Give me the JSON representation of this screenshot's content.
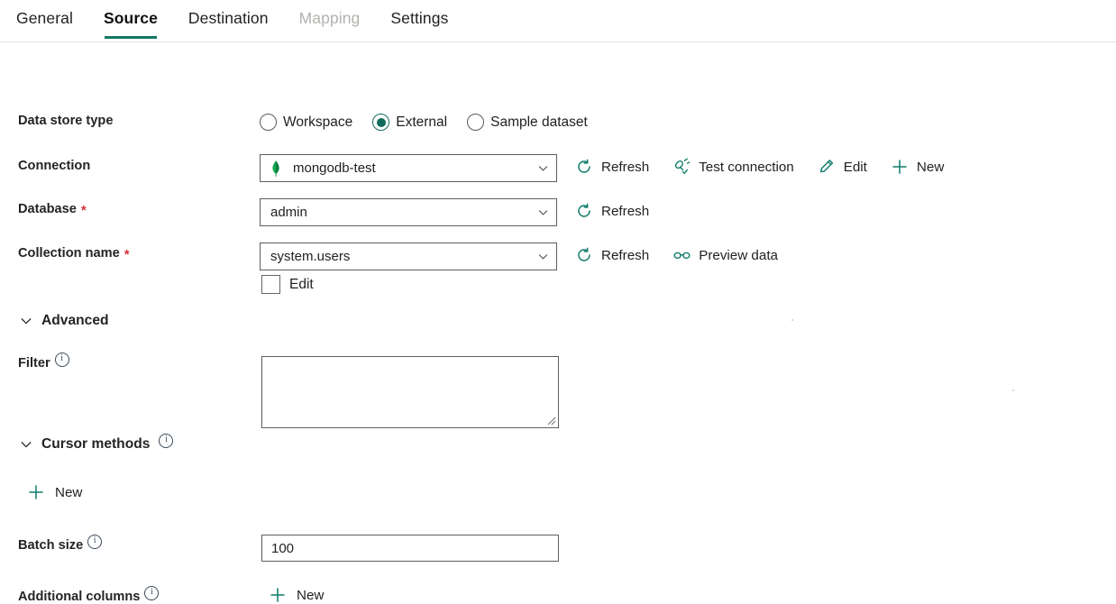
{
  "tabs": [
    {
      "label": "General",
      "state": "normal"
    },
    {
      "label": "Source",
      "state": "active"
    },
    {
      "label": "Destination",
      "state": "normal"
    },
    {
      "label": "Mapping",
      "state": "disabled"
    },
    {
      "label": "Settings",
      "state": "normal"
    }
  ],
  "colors": {
    "accent_teal": "#117865",
    "radio_selected": "#0f6b5c",
    "icon_teal": "#0f7b6c",
    "required_red": "#d13438",
    "mongo_green": "#13aa52",
    "border": "#605e5c",
    "disabled_text": "#b4b1ae"
  },
  "fields": {
    "data_store_type": {
      "label": "Data store type",
      "options": [
        {
          "label": "Workspace",
          "selected": false
        },
        {
          "label": "External",
          "selected": true
        },
        {
          "label": "Sample dataset",
          "selected": false
        }
      ]
    },
    "connection": {
      "label": "Connection",
      "value": "mongodb-test",
      "icon": "mongodb-leaf-icon",
      "dropdown_icon": "chevron-down-icon",
      "commands": [
        {
          "label": "Refresh",
          "icon": "refresh-icon"
        },
        {
          "label": "Test connection",
          "icon": "plug-check-icon"
        },
        {
          "label": "Edit",
          "icon": "pencil-icon"
        },
        {
          "label": "New",
          "icon": "plus-icon"
        }
      ]
    },
    "database": {
      "label": "Database",
      "required": "*",
      "value": "admin",
      "dropdown_icon": "chevron-down-icon",
      "commands": [
        {
          "label": "Refresh",
          "icon": "refresh-icon"
        }
      ]
    },
    "collection_name": {
      "label": "Collection name",
      "required": "*",
      "value": "system.users",
      "dropdown_icon": "chevron-down-icon",
      "commands": [
        {
          "label": "Refresh",
          "icon": "refresh-icon"
        },
        {
          "label": "Preview data",
          "icon": "glasses-icon"
        }
      ],
      "edit_checkbox": {
        "label": "Edit",
        "checked": false
      }
    },
    "advanced_section": {
      "title": "Advanced",
      "expanded": true,
      "caret_icon": "chevron-down-icon"
    },
    "filter": {
      "label": "Filter",
      "info_icon": "info-icon",
      "value": "",
      "resize_handle": "resize-grip-icon"
    },
    "cursor_methods": {
      "title": "Cursor methods",
      "expanded": true,
      "caret_icon": "chevron-down-icon",
      "info_icon": "info-icon",
      "new_label": "New",
      "new_icon": "plus-icon"
    },
    "batch_size": {
      "label": "Batch size",
      "info_icon": "info-icon",
      "value": "100"
    },
    "additional_columns": {
      "label": "Additional columns",
      "info_icon": "info-icon",
      "new_label": "New",
      "new_icon": "plus-icon"
    }
  }
}
